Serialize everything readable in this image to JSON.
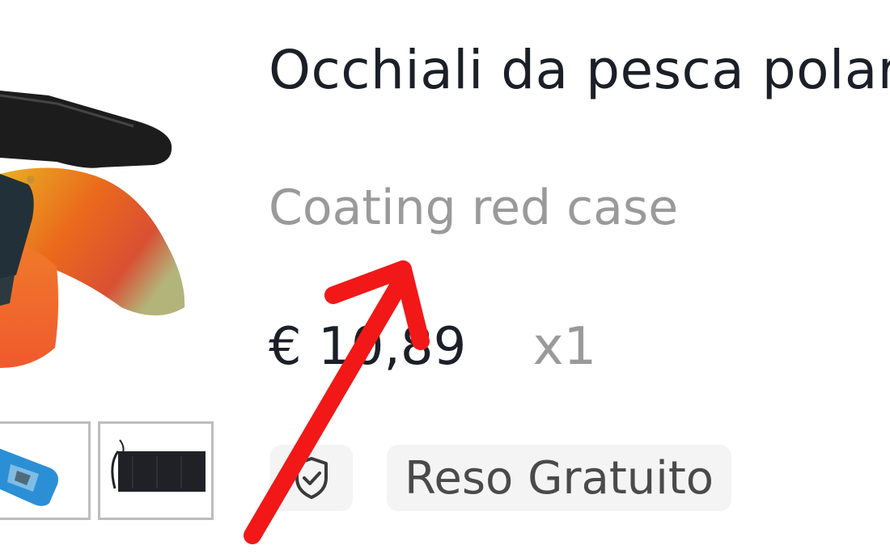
{
  "product": {
    "title": "Occhiali da pesca polar",
    "variant": "Coating red case",
    "price": "€ 10,89",
    "quantity": "x1",
    "return_badge": "Reso Gratuito"
  },
  "icons": {
    "badge_icon": "shield-check-icon",
    "annotation": "red-arrow-icon"
  },
  "colors": {
    "title": "#1b1f27",
    "muted": "#9a9a9a",
    "badge_bg": "#f4f4f4",
    "annotation_arrow": "#f21818"
  }
}
